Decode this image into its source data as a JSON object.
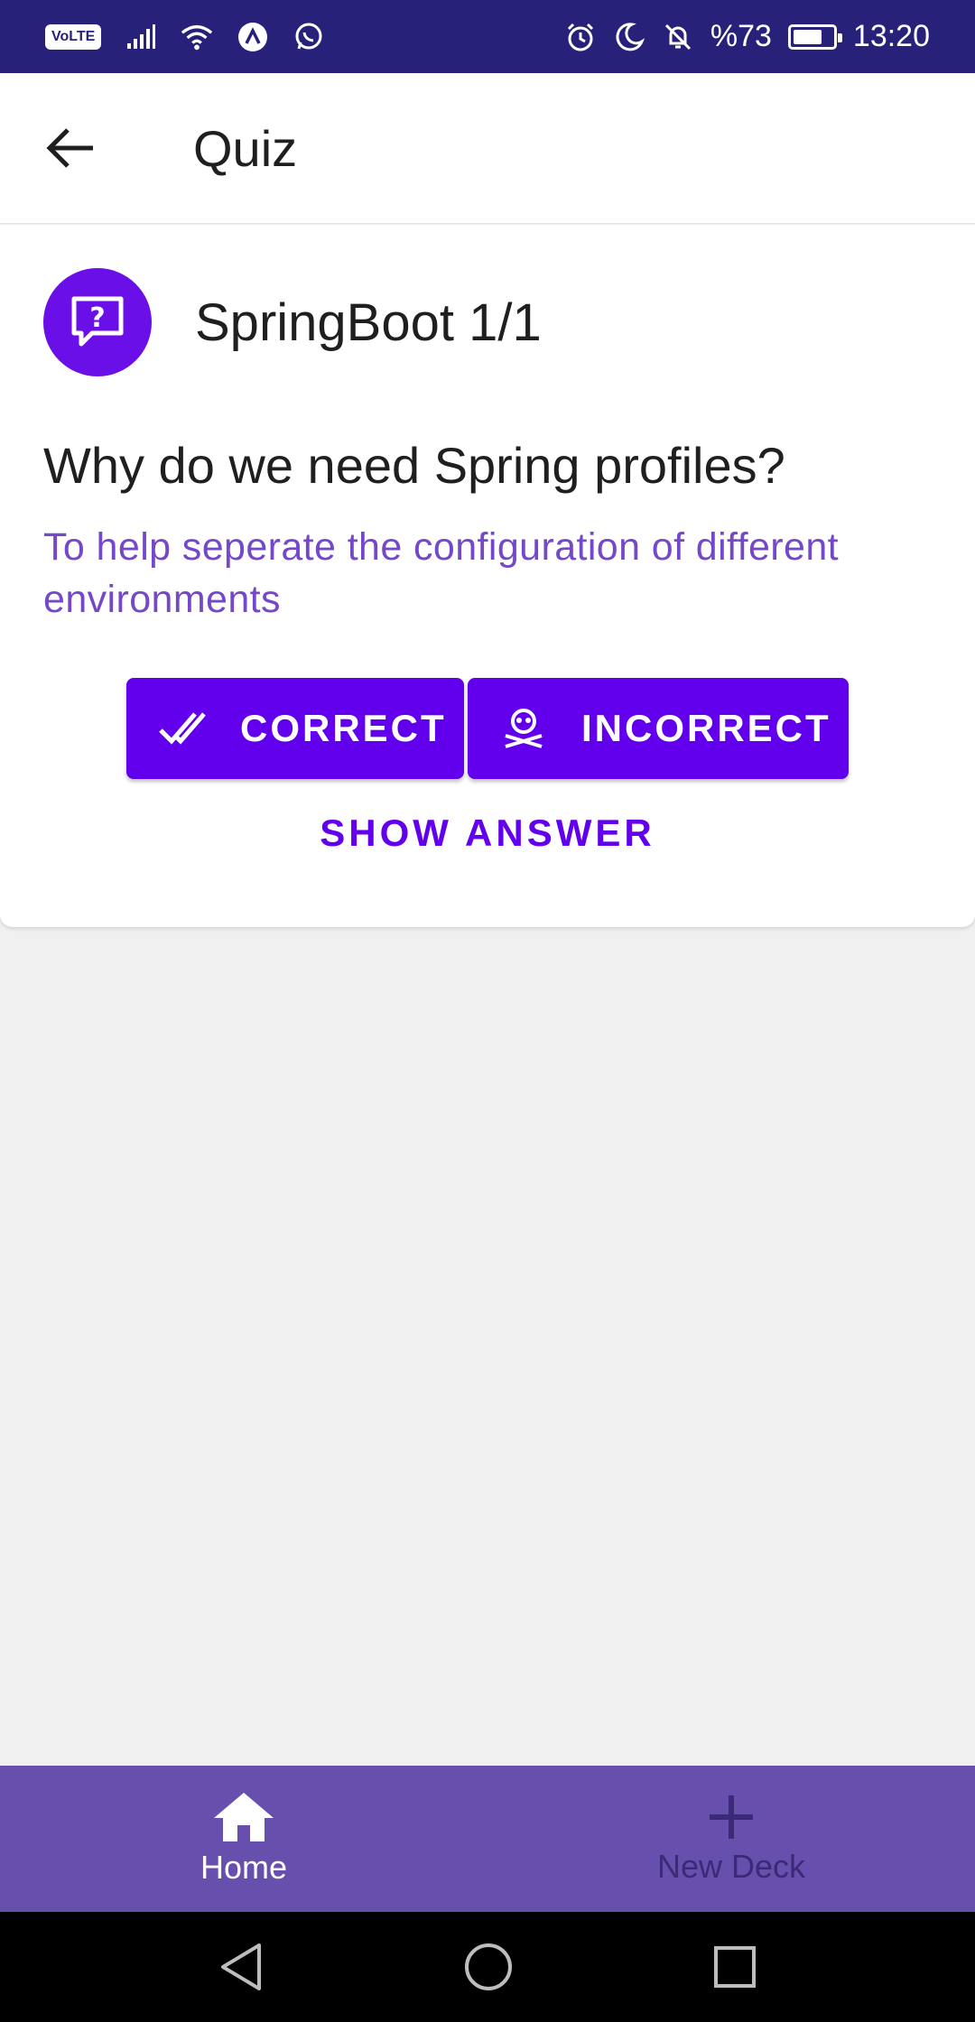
{
  "status_bar": {
    "volte": "VoLTE",
    "battery_text": "%73",
    "battery_level": 0.73,
    "time": "13:20"
  },
  "app_bar": {
    "title": "Quiz"
  },
  "card": {
    "deck_title": "SpringBoot 1/1",
    "question": "Why do we need Spring profiles?",
    "answer": "To help seperate the configuration of different environments",
    "correct_label": "CORRECT",
    "incorrect_label": "INCORRECT",
    "show_answer_label": "SHOW ANSWER"
  },
  "bottom_nav": {
    "items": [
      {
        "label": "Home",
        "icon": "home-icon",
        "active": true
      },
      {
        "label": "New Deck",
        "icon": "plus-icon",
        "active": false
      }
    ]
  },
  "colors": {
    "status_bar": "#27217a",
    "primary": "#6200ee",
    "answer_text": "#7448c8",
    "bottom_nav": "#6750ad"
  }
}
